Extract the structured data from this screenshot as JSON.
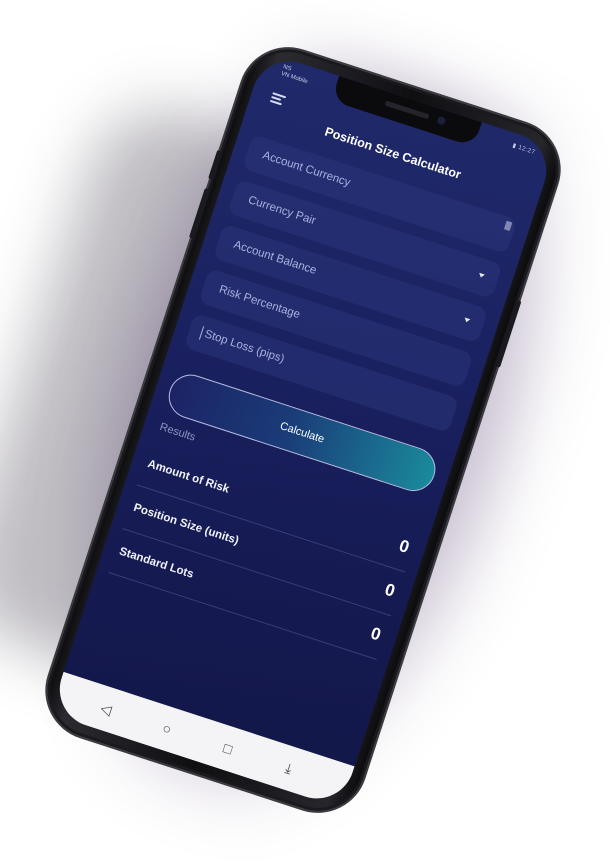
{
  "app": {
    "title": "Position Size Calculator"
  },
  "statusbar": {
    "carrier_line1": "NS",
    "carrier_line2": "VN Mobile",
    "time": "12:27",
    "battery": "▮"
  },
  "icons": {
    "menu": "hamburger-icon",
    "lock": "lock-icon",
    "dropdown": "chevron-down-icon"
  },
  "form": {
    "fields": [
      {
        "label": "Account Currency",
        "dropdown": false
      },
      {
        "label": "Currency Pair",
        "dropdown": true
      },
      {
        "label": "Account Balance",
        "dropdown": true
      },
      {
        "label": "Risk Percentage",
        "dropdown": false
      },
      {
        "label": "Stop Loss (pips)",
        "dropdown": false
      }
    ],
    "calculate_label": "Calculate"
  },
  "results": {
    "label": "Results",
    "rows": [
      {
        "label": "Amount of Risk",
        "value": "0"
      },
      {
        "label": "Position Size (units)",
        "value": "0"
      },
      {
        "label": "Standard Lots",
        "value": "0"
      }
    ]
  },
  "navbar": {
    "back": "◁",
    "home": "○",
    "recents": "□",
    "extra": "⤓"
  },
  "colors": {
    "screen_bg": "#1a2160",
    "button_gradient_end": "#1a8a9c",
    "navbar_bg": "#f4f4f6"
  }
}
